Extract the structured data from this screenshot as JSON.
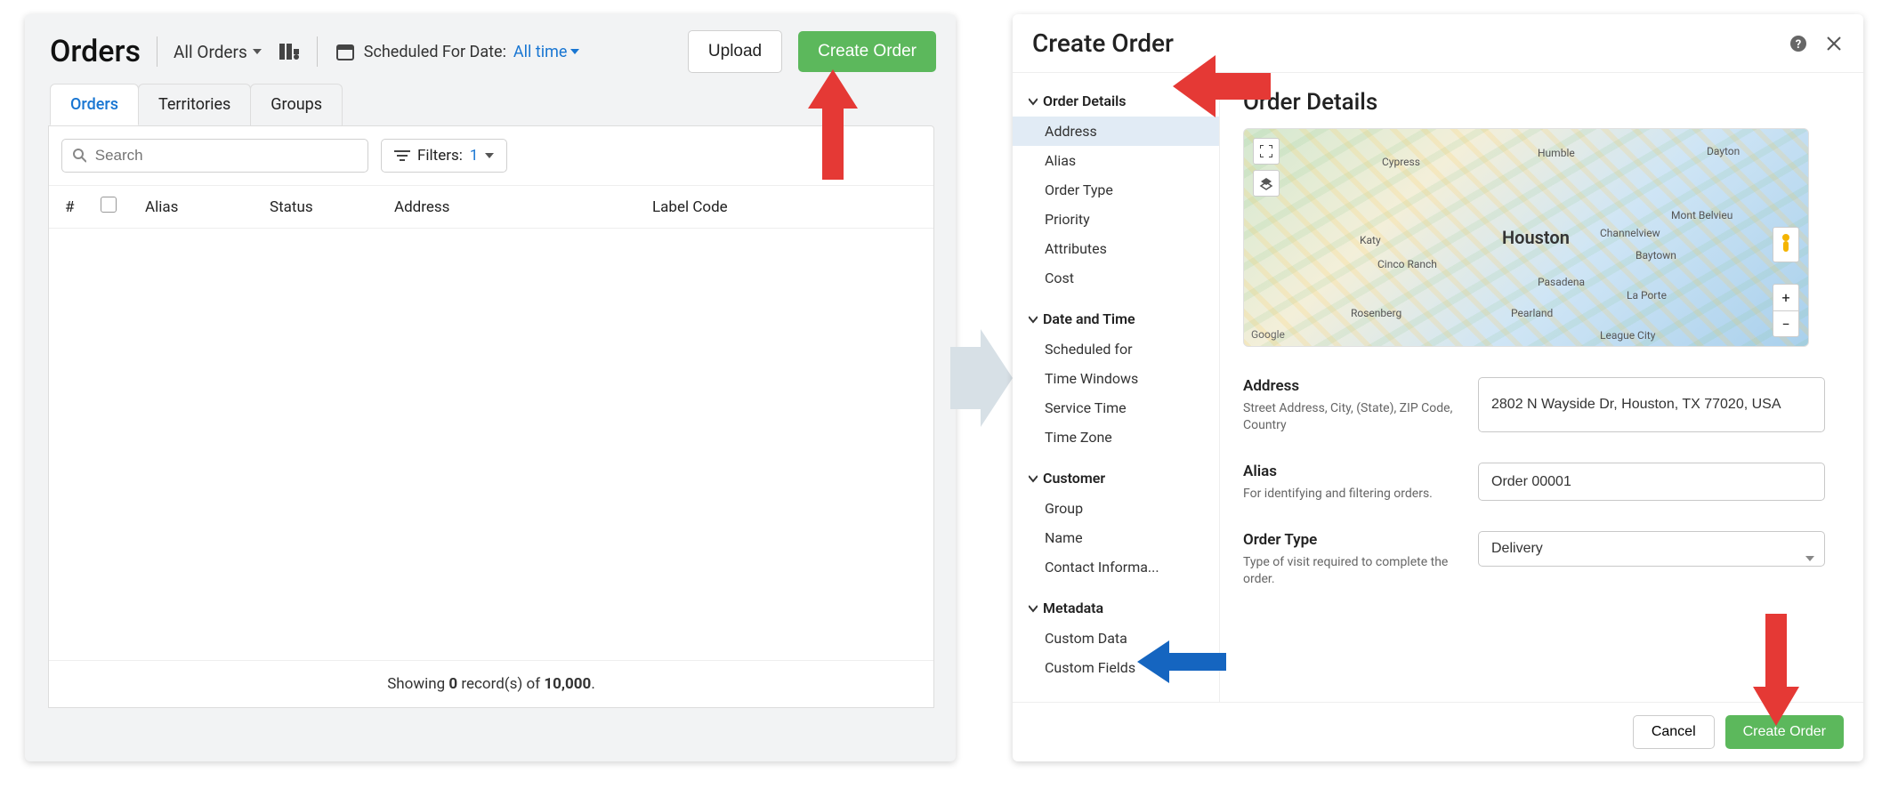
{
  "left": {
    "title": "Orders",
    "filter_dropdown": "All Orders",
    "scheduled_label": "Scheduled For Date:",
    "scheduled_value": "All time",
    "upload_label": "Upload",
    "create_label": "Create Order",
    "tabs": [
      "Orders",
      "Territories",
      "Groups"
    ],
    "search_placeholder": "Search",
    "filters_label": "Filters:",
    "filters_count": "1",
    "columns": {
      "num": "#",
      "alias": "Alias",
      "status": "Status",
      "address": "Address",
      "label": "Label Code"
    },
    "footer_prefix": "Showing ",
    "footer_record_count": "0",
    "footer_mid": " record(s) of ",
    "footer_total": "10,000",
    "footer_suffix": "."
  },
  "right": {
    "title": "Create Order",
    "sidebar": {
      "sections": [
        {
          "title": "Order Details",
          "items": [
            "Address",
            "Alias",
            "Order Type",
            "Priority",
            "Attributes",
            "Cost"
          ],
          "active": "Address"
        },
        {
          "title": "Date and Time",
          "items": [
            "Scheduled for",
            "Time Windows",
            "Service Time",
            "Time Zone"
          ]
        },
        {
          "title": "Customer",
          "items": [
            "Group",
            "Name",
            "Contact Informa..."
          ]
        },
        {
          "title": "Metadata",
          "items": [
            "Custom Data",
            "Custom Fields"
          ]
        }
      ]
    },
    "content": {
      "section_title": "Order Details",
      "map": {
        "city": "Houston",
        "labels": [
          "Cypress",
          "Humble",
          "Dayton",
          "Katy",
          "Pasadena",
          "Baytown",
          "Channelview",
          "Mont Belvieu",
          "La Porte",
          "Pearland",
          "Rosenberg",
          "League City",
          "Cinco Ranch"
        ],
        "brand": "Google"
      },
      "address_label": "Address",
      "address_hint": "Street Address, City, (State), ZIP Code, Country",
      "address_value": "2802 N Wayside Dr, Houston, TX 77020, USA",
      "alias_label": "Alias",
      "alias_hint": "For identifying and filtering orders.",
      "alias_value": "Order 00001",
      "ordertype_label": "Order Type",
      "ordertype_hint": "Type of visit required to complete the order.",
      "ordertype_value": "Delivery"
    },
    "footer": {
      "cancel": "Cancel",
      "create": "Create Order"
    }
  }
}
